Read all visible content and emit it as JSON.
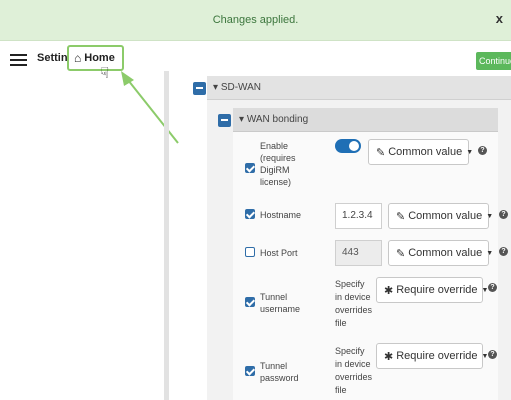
{
  "banner": {
    "message": "Changes applied.",
    "close_label": "x"
  },
  "header": {
    "settings_label": "Settings",
    "home_label": "Home",
    "continue_label": "Continue"
  },
  "sdwan": {
    "title": "SD-WAN",
    "collapse_glyph": "▾"
  },
  "wan_bonding": {
    "title": "WAN bonding",
    "fields": [
      {
        "label": "Enable (requires DigiRM license)",
        "label_lines": [
          "Enable",
          "(requires",
          "DigiRM",
          "license)"
        ],
        "checked": true,
        "control": "toggle",
        "toggle_on": true,
        "dropdown": "Common value"
      },
      {
        "label": "Hostname",
        "checked": true,
        "value": "1.2.3.4",
        "dropdown": "Common value"
      },
      {
        "label": "Host Port",
        "checked": false,
        "value": "443",
        "value_disabled": true,
        "dropdown": "Common value"
      },
      {
        "label": "Tunnel username",
        "label_lines": [
          "Tunnel",
          "username"
        ],
        "checked": true,
        "note_lines": [
          "Specify",
          "in device",
          "overrides",
          "file"
        ],
        "dropdown": "Require override"
      },
      {
        "label": "Tunnel password",
        "label_lines": [
          "Tunnel",
          "password"
        ],
        "checked": true,
        "note_lines": [
          "Specify",
          "in device",
          "overrides",
          "file"
        ],
        "dropdown": "Require override"
      }
    ]
  },
  "icons": {
    "home": "home-icon",
    "edit": "pencil-square-icon",
    "asterisk": "asterisk-icon",
    "help": "question-circle-icon",
    "caret": "caret-down-icon",
    "cursor": "hand-pointer-icon"
  },
  "colors": {
    "banner_bg": "#dff0d8",
    "banner_text": "#3c763d",
    "accent_blue": "#2f6da8",
    "toggle_on": "#1f6fb5",
    "continue_green": "#5cb85c",
    "highlight_green": "#8ccb6a"
  }
}
